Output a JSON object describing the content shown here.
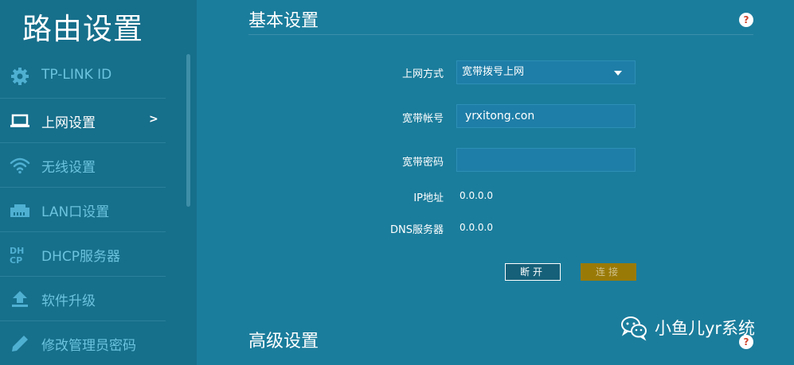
{
  "sidebar": {
    "title": "路由设置",
    "items": [
      {
        "label": "TP-LINK ID",
        "icon": "gear-icon"
      },
      {
        "label": "上网设置",
        "icon": "laptop-icon",
        "active": true,
        "arrow": ">"
      },
      {
        "label": "无线设置",
        "icon": "wifi-icon"
      },
      {
        "label": "LAN口设置",
        "icon": "lan-port-icon"
      },
      {
        "label": "DHCP服务器",
        "icon": "dhcp-icon"
      },
      {
        "label": "软件升级",
        "icon": "upload-icon"
      },
      {
        "label": "修改管理员密码",
        "icon": "pencil-icon"
      }
    ]
  },
  "main": {
    "basic_title": "基本设置",
    "advanced_title": "高级设置",
    "help_glyph": "?",
    "fields": {
      "connection_type": {
        "label": "上网方式",
        "value": "宽带拨号上网"
      },
      "account": {
        "label": "宽带帐号",
        "value": "yrxitong.con"
      },
      "password": {
        "label": "宽带密码",
        "value": ""
      },
      "ip": {
        "label": "IP地址",
        "value": "0.0.0.0"
      },
      "dns": {
        "label": "DNS服务器",
        "value": "0.0.0.0"
      }
    },
    "buttons": {
      "disconnect": "断开",
      "connect": "连接"
    }
  },
  "watermark": {
    "text": "小鱼儿yr系统",
    "icon": "wechat-icon"
  },
  "colors": {
    "sidebar_bg": "#166f8b",
    "main_bg": "#1b7d9c",
    "connect_btn": "#9a7a07",
    "help_icon": "#d0452d"
  }
}
